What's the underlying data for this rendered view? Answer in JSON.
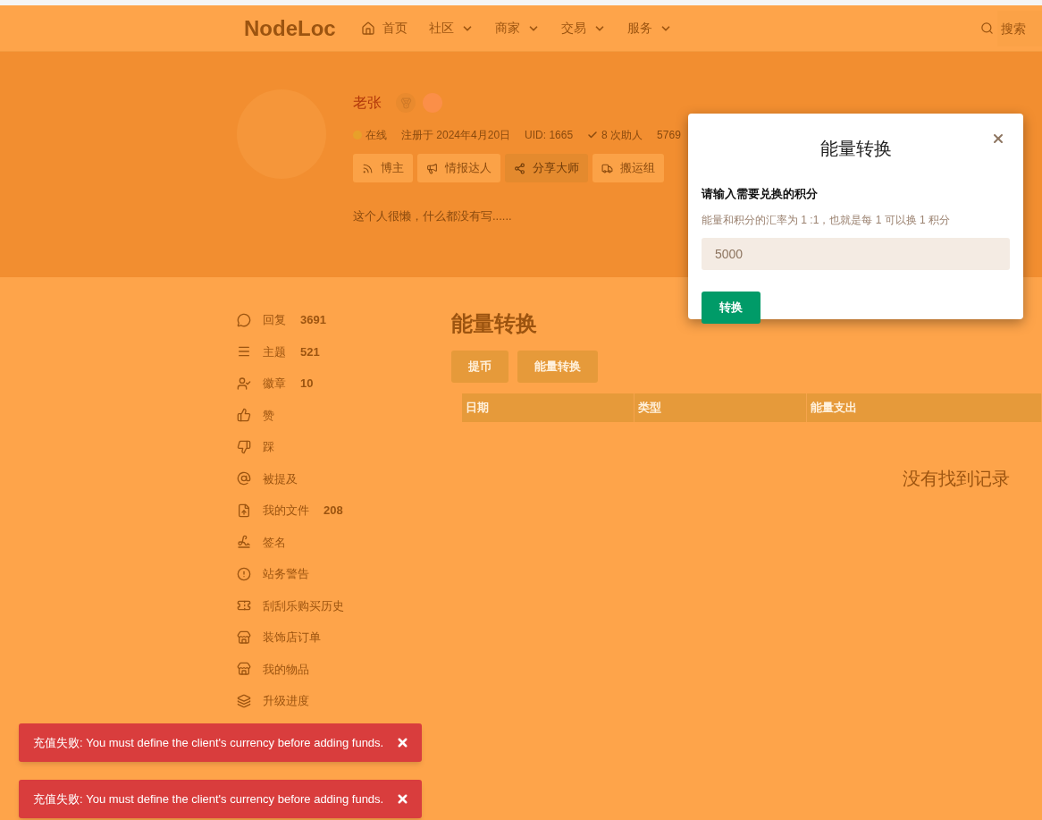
{
  "nav": {
    "logo": "NodeLoc",
    "items": [
      {
        "label": "首页",
        "dropdown": false
      },
      {
        "label": "社区",
        "dropdown": true
      },
      {
        "label": "商家",
        "dropdown": true
      },
      {
        "label": "交易",
        "dropdown": true
      },
      {
        "label": "服务",
        "dropdown": true
      }
    ],
    "search": {
      "placeholder": "搜索"
    }
  },
  "profile": {
    "name": "老张",
    "online": true,
    "status": "在线",
    "registered": "注册于 2024年4月20日",
    "uid": "UID: 1665",
    "helped": "8 次助人",
    "stat_cut": "5769",
    "bio": "这个人很懒，什么都没有写......",
    "groups": [
      {
        "label": "博主",
        "selected": false
      },
      {
        "label": "情报达人",
        "selected": false
      },
      {
        "label": "分享大师",
        "selected": true
      },
      {
        "label": "搬运组",
        "selected": false
      }
    ]
  },
  "sidebar": {
    "items": [
      {
        "label": "回复",
        "count": "3691"
      },
      {
        "label": "主题",
        "count": "521"
      },
      {
        "label": "徽章",
        "count": "10"
      },
      {
        "label": "赞"
      },
      {
        "label": "踩"
      },
      {
        "label": "被提及"
      },
      {
        "label": "我的文件",
        "count": "208"
      },
      {
        "label": "签名"
      },
      {
        "label": "站务警告"
      },
      {
        "label": "刮刮乐购买历史"
      },
      {
        "label": "装饰店订单"
      },
      {
        "label": "我的物品"
      },
      {
        "label": "升级进度"
      }
    ]
  },
  "main": {
    "title": "能量转换",
    "buttons": [
      "提币",
      "能量转换"
    ],
    "table": {
      "columns": [
        "日期",
        "类型",
        "能量支出"
      ],
      "empty": "没有找到记录"
    }
  },
  "modal": {
    "title": "能量转换",
    "label": "请输入需要兑换的积分",
    "help": "能量和积分的汇率为 1 :1，也就是每 1 可以换 1 积分",
    "value": "5000",
    "submit": "转换"
  },
  "toasts": [
    {
      "message": "充值失败: You must define the client's currency before adding funds."
    },
    {
      "message": "充值失败: You must define the client's currency before adding funds."
    }
  ]
}
